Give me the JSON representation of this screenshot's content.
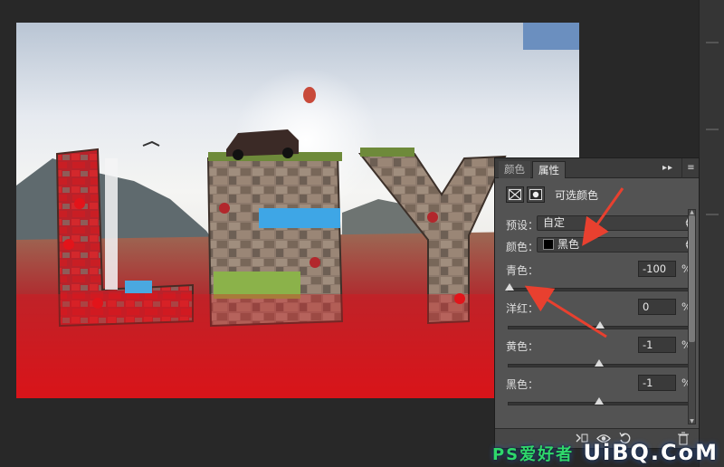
{
  "panel": {
    "tabs": [
      {
        "label": "颜色",
        "active": false
      },
      {
        "label": "属性",
        "active": true
      }
    ],
    "tab_controls": "▸▸",
    "tab_menu": "≡",
    "adjustment_title": "可选颜色",
    "preset_label": "预设：",
    "preset_value": "自定",
    "colors_label": "颜色：",
    "colors_value": "黑色",
    "swatch_color": "#000000",
    "sliders": [
      {
        "label": "青色：",
        "value": "-100",
        "unit": "%",
        "fraction": 0.0
      },
      {
        "label": "洋红：",
        "value": "0",
        "unit": "%",
        "fraction": 0.5
      },
      {
        "label": "黄色：",
        "value": "-1",
        "unit": "%",
        "fraction": 0.495
      },
      {
        "label": "黑色：",
        "value": "-1",
        "unit": "%",
        "fraction": 0.495
      }
    ],
    "footer_icons": [
      "clip-to-layer-icon",
      "visibility-eye-icon",
      "reset-icon",
      "trash-icon"
    ]
  },
  "annotation_color": "#e8402f",
  "watermark": {
    "text": "UiBQ.CoM",
    "overlay": "PS爱好者"
  }
}
